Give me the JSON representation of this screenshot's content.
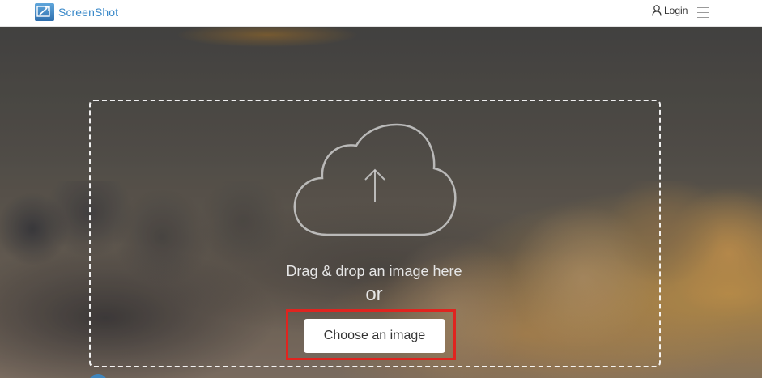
{
  "header": {
    "logo_text": "ScreenShot",
    "logo_icon": "screenshot-logo-icon",
    "login_label": "Login",
    "login_icon": "user-icon",
    "menu_icon": "hamburger-menu-icon"
  },
  "upload": {
    "icon": "cloud-upload-icon",
    "drag_text": "Drag & drop an image here",
    "or_text": "or",
    "choose_button": "Choose an image"
  },
  "colors": {
    "brand": "#3a89c9",
    "highlight": "#e0241f",
    "dropzone_border": "#ffffff"
  }
}
